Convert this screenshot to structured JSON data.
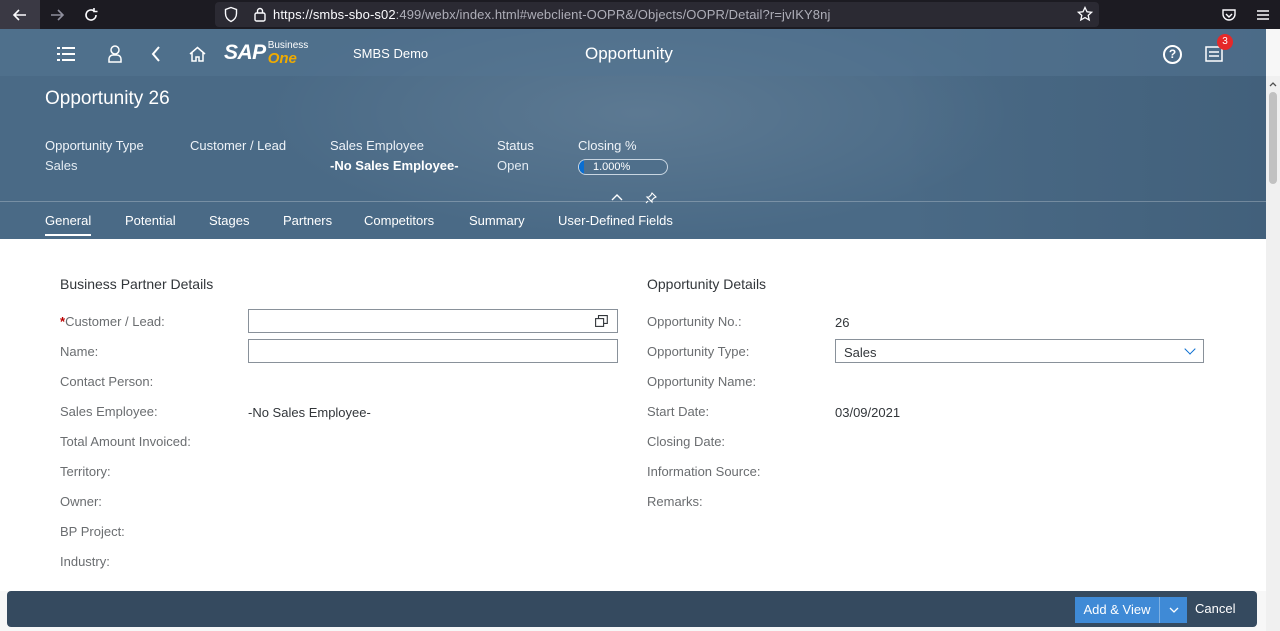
{
  "browser": {
    "url_main": "https://smbs-sbo-s02",
    "url_rest": ":499/webx/index.html#webclient-OOPR&/Objects/OOPR/Detail?r=jvIKY8nj"
  },
  "shell": {
    "company": "SMBS Demo",
    "title": "Opportunity",
    "logo_sap": "SAP",
    "logo_business": "Business",
    "logo_one": "One",
    "notification_count": "3",
    "help_glyph": "?"
  },
  "header": {
    "object_title": "Opportunity 26",
    "kpis": [
      {
        "label": "Opportunity Type",
        "value": "Sales"
      },
      {
        "label": "Customer / Lead",
        "value": ""
      },
      {
        "label": "Sales Employee",
        "value": "-No Sales Employee-"
      },
      {
        "label": "Status",
        "value": "Open"
      },
      {
        "label": "Closing %",
        "value": "1.000%",
        "fraction": 0.01
      }
    ]
  },
  "tabs": [
    "General",
    "Potential",
    "Stages",
    "Partners",
    "Competitors",
    "Summary",
    "User-Defined Fields"
  ],
  "bp_details": {
    "title": "Business Partner Details",
    "fields": [
      {
        "label": "Customer / Lead:",
        "value": ""
      },
      {
        "label": "Name:",
        "value": ""
      },
      {
        "label": "Contact Person:",
        "value": ""
      },
      {
        "label": "Sales Employee:",
        "value": "-No Sales Employee-"
      },
      {
        "label": "Total Amount Invoiced:",
        "value": ""
      },
      {
        "label": "Territory:",
        "value": ""
      },
      {
        "label": "Owner:",
        "value": ""
      },
      {
        "label": "BP Project:",
        "value": ""
      },
      {
        "label": "Industry:",
        "value": ""
      }
    ],
    "required_marker": "*"
  },
  "opp_details": {
    "title": "Opportunity Details",
    "fields": [
      {
        "label": "Opportunity No.:",
        "value": "26"
      },
      {
        "label": "Opportunity Type:",
        "value": "Sales"
      },
      {
        "label": "Opportunity Name:",
        "value": ""
      },
      {
        "label": "Start Date:",
        "value": "03/09/2021"
      },
      {
        "label": "Closing Date:",
        "value": ""
      },
      {
        "label": "Information Source:",
        "value": ""
      },
      {
        "label": "Remarks:",
        "value": ""
      }
    ]
  },
  "footer": {
    "primary_label": "Add & View",
    "cancel_label": "Cancel"
  },
  "colors": {
    "shell_bg": "#4a6a86",
    "footer_bg": "#354a5f",
    "accent": "#0a6ed1",
    "notification": "#e52929"
  }
}
